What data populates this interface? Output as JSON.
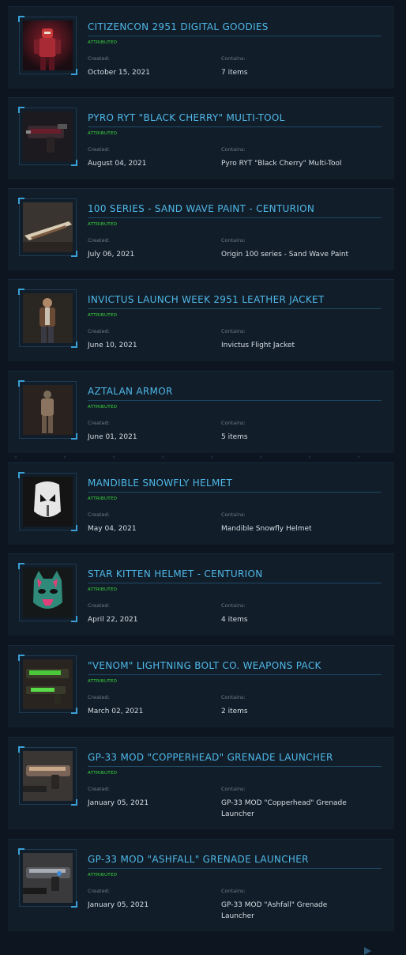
{
  "pledges": [
    {
      "title": "CITIZENCON 2951 DIGITAL GOODIES",
      "status": "ATTRIBUTED",
      "created_label": "Created:",
      "created": "October 15, 2021",
      "contains_label": "Contains:",
      "contains": "7 items",
      "thumb_icon": "red-armor-character"
    },
    {
      "title": "PYRO RYT \"BLACK CHERRY\" MULTI-TOOL",
      "status": "ATTRIBUTED",
      "created_label": "Created:",
      "created": "August 04, 2021",
      "contains_label": "Contains:",
      "contains": "Pyro RYT \"Black Cherry\" Multi-Tool",
      "thumb_icon": "multi-tool"
    },
    {
      "title": "100 SERIES - SAND WAVE PAINT - CENTURION",
      "status": "ATTRIBUTED",
      "created_label": "Created:",
      "created": "July 06, 2021",
      "contains_label": "Contains:",
      "contains": "Origin 100 series - Sand Wave Paint",
      "thumb_icon": "ship-paint"
    },
    {
      "title": "INVICTUS LAUNCH WEEK 2951 LEATHER JACKET",
      "status": "ATTRIBUTED",
      "created_label": "Created:",
      "created": "June 10, 2021",
      "contains_label": "Contains:",
      "contains": "Invictus Flight Jacket",
      "thumb_icon": "jacket-character"
    },
    {
      "title": "AZTALAN ARMOR",
      "status": "ATTRIBUTED",
      "created_label": "Created:",
      "created": "June 01, 2021",
      "contains_label": "Contains:",
      "contains": "5 items",
      "thumb_icon": "armor-character"
    },
    {
      "title": "MANDIBLE SNOWFLY HELMET",
      "status": "ATTRIBUTED",
      "created_label": "Created:",
      "created": "May 04, 2021",
      "contains_label": "Contains:",
      "contains": "Mandible Snowfly Helmet",
      "thumb_icon": "white-helmet"
    },
    {
      "title": "STAR KITTEN HELMET - CENTURION",
      "status": "ATTRIBUTED",
      "created_label": "Created:",
      "created": "April 22, 2021",
      "contains_label": "Contains:",
      "contains": "4 items",
      "thumb_icon": "kitten-helmet"
    },
    {
      "title": "\"VENOM\" LIGHTNING BOLT CO. WEAPONS PACK",
      "status": "ATTRIBUTED",
      "created_label": "Created:",
      "created": "March 02, 2021",
      "contains_label": "Contains:",
      "contains": "2 items",
      "thumb_icon": "green-weapons"
    },
    {
      "title": "GP-33 MOD \"COPPERHEAD\" GRENADE LAUNCHER",
      "status": "ATTRIBUTED",
      "created_label": "Created:",
      "created": "January 05, 2021",
      "contains_label": "Contains:",
      "contains": "GP-33 MOD \"Copperhead\" Grenade Launcher",
      "thumb_icon": "grenade-launcher"
    },
    {
      "title": "GP-33 MOD \"ASHFALL\" GRENADE LAUNCHER",
      "status": "ATTRIBUTED",
      "created_label": "Created:",
      "created": "January 05, 2021",
      "contains_label": "Contains:",
      "contains": "GP-33 MOD \"Ashfall\" Grenade Launcher",
      "thumb_icon": "grenade-launcher"
    }
  ]
}
